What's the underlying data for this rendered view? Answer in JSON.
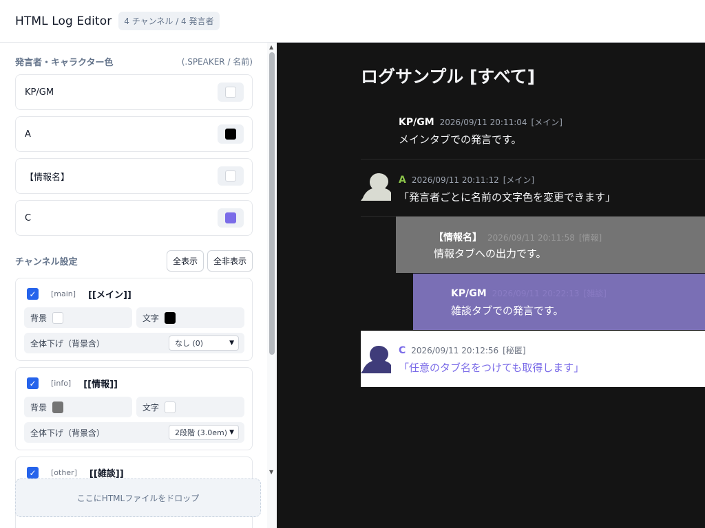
{
  "header": {
    "title": "HTML Log Editor",
    "badge": "4 チャンネル / 4 発言者"
  },
  "speakers_section": {
    "title": "発言者・キャラクター色",
    "hint": "(.SPEAKER / 名前)"
  },
  "speakers": [
    {
      "name": "KP/GM",
      "color": "#ffffff"
    },
    {
      "name": "A",
      "color": "#000000"
    },
    {
      "name": "【情報名】",
      "color": "#ffffff"
    },
    {
      "name": "C",
      "color": "#7b6ce8"
    }
  ],
  "channels_section": {
    "title": "チャンネル設定",
    "show_all": "全表示",
    "hide_all": "全非表示"
  },
  "channels": [
    {
      "id": "[main]",
      "name": "[[メイン]]",
      "bg_label": "背景",
      "bg_color": "#ffffff",
      "text_label": "文字",
      "text_color": "#000000",
      "indent_label": "全体下げ（背景含）",
      "indent_value": "なし (0)",
      "checked": true
    },
    {
      "id": "[info]",
      "name": "[[情報]]",
      "bg_label": "背景",
      "bg_color": "#747474",
      "text_label": "文字",
      "text_color": "#ffffff",
      "indent_label": "全体下げ（背景含）",
      "indent_value": "2段階 (3.0em)",
      "checked": true
    },
    {
      "id": "[other]",
      "name": "[[雑談]]",
      "checked": true
    }
  ],
  "drop_zone": "ここにHTMLファイルをドロップ",
  "preview": {
    "title": "ログサンプル [すべて]",
    "messages": [
      {
        "name": "KP/GM",
        "time": "2026/09/11 20:11:04",
        "tab": "[メイン]",
        "body": "メインタブでの発言です。",
        "name_color": "#ffffff",
        "meta_color": "#9ca3af",
        "body_color": "#f3f4f6",
        "bg": "transparent"
      },
      {
        "name": "A",
        "time": "2026/09/11 20:11:12",
        "tab": "[メイン]",
        "body": "「発言者ごとに名前の文字色を変更できます」",
        "name_color": "#8bc34a",
        "meta_color": "#9ca3af",
        "body_color": "#f3f4f6",
        "bg": "transparent"
      },
      {
        "name": "【情報名】",
        "time": "2026/09/11 20:11:58",
        "tab": "[情報]",
        "body": "情報タブへの出力です。",
        "name_color": "#ffffff",
        "meta_color": "#9a9a9a",
        "body_color": "#ffffff",
        "bg": "#747474"
      },
      {
        "name": "KP/GM",
        "time": "2026/09/11 20:22:13",
        "tab": "[雑談]",
        "body": "雑談タブでの発言です。",
        "name_color": "#ffffff",
        "meta_color": "#8a7cc4",
        "body_color": "#ffffff",
        "bg": "#7a6fb5"
      },
      {
        "name": "C",
        "time": "2026/09/11 20:12:56",
        "tab": "[秘匿]",
        "body": "「任意のタブ名をつけても取得します」",
        "name_color": "#7b6ce8",
        "meta_color": "#6b7280",
        "body_color": "#7b6ce8",
        "bg": "#ffffff"
      }
    ]
  },
  "icons": {
    "check": "check-icon",
    "caret": "chevron-down-icon",
    "avatar": "silhouette-avatar-icon"
  }
}
